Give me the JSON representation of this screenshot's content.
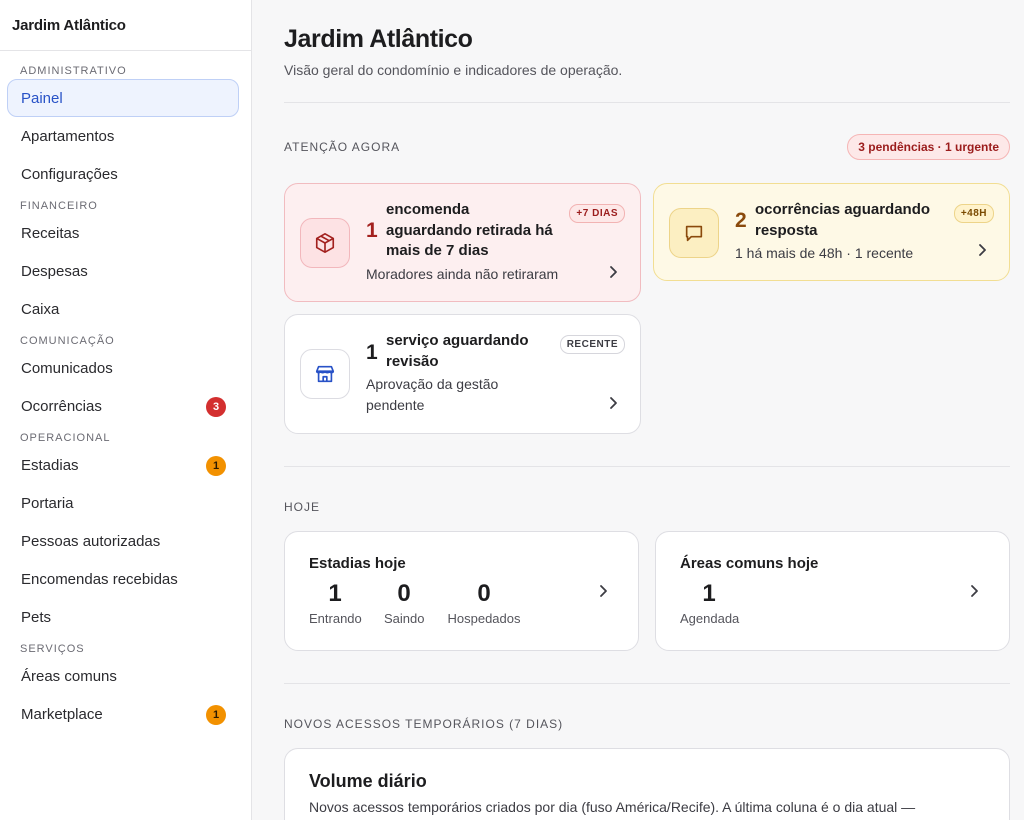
{
  "sidebar": {
    "brand": "Jardim Atlântico",
    "sections": [
      {
        "title": "ADMINISTRATIVO",
        "items": [
          {
            "label": "Painel",
            "active": true
          },
          {
            "label": "Apartamentos"
          },
          {
            "label": "Configurações"
          }
        ]
      },
      {
        "title": "FINANCEIRO",
        "items": [
          {
            "label": "Receitas"
          },
          {
            "label": "Despesas"
          },
          {
            "label": "Caixa"
          }
        ]
      },
      {
        "title": "COMUNICAÇÃO",
        "items": [
          {
            "label": "Comunicados"
          },
          {
            "label": "Ocorrências",
            "badge": "3",
            "badge_color": "#d32f2f"
          }
        ]
      },
      {
        "title": "OPERACIONAL",
        "items": [
          {
            "label": "Estadias",
            "badge": "1",
            "badge_color": "#f29100"
          },
          {
            "label": "Portaria"
          },
          {
            "label": "Pessoas autorizadas"
          },
          {
            "label": "Encomendas recebidas"
          },
          {
            "label": "Pets"
          }
        ]
      },
      {
        "title": "SERVIÇOS",
        "items": [
          {
            "label": "Áreas comuns"
          },
          {
            "label": "Marketplace",
            "badge": "1",
            "badge_color": "#f29100"
          }
        ]
      }
    ]
  },
  "header": {
    "title": "Jardim Atlântico",
    "subtitle": "Visão geral do condomínio e indicadores de operação."
  },
  "attention": {
    "label": "ATENÇÃO AGORA",
    "summary_pill": "3 pendências · 1 urgente",
    "cards": [
      {
        "number": "1",
        "title_line1": "encomenda",
        "title_line2": "aguardando retirada há",
        "title_line3": "mais de 7 dias",
        "desc": "Moradores ainda não retiraram",
        "tag": "+7 DIAS",
        "icon": "package-icon"
      },
      {
        "number": "2",
        "title_line1": "ocorrências aguardando",
        "title_line2": "resposta",
        "desc": "1 há mais de 48h · 1 recente",
        "tag": "+48H",
        "icon": "message-icon"
      },
      {
        "number": "1",
        "title_line1": "serviço aguardando",
        "title_line2": "revisão",
        "desc_line1": "Aprovação da gestão",
        "desc_line2": "pendente",
        "tag": "RECENTE",
        "icon": "store-icon"
      }
    ]
  },
  "today": {
    "label": "HOJE",
    "stays": {
      "title": "Estadias hoje",
      "stats": [
        {
          "value": "1",
          "label": "Entrando"
        },
        {
          "value": "0",
          "label": "Saindo"
        },
        {
          "value": "0",
          "label": "Hospedados"
        }
      ]
    },
    "areas": {
      "title": "Áreas comuns hoje",
      "stats": [
        {
          "value": "1",
          "label": "Agendada"
        }
      ]
    }
  },
  "access": {
    "label": "NOVOS ACESSOS TEMPORÁRIOS (7 DIAS)",
    "card_title": "Volume diário",
    "card_desc": "Novos acessos temporários criados por dia (fuso América/Recife). A última coluna é o dia atual —"
  },
  "colors": {
    "accent": "#2852c7",
    "urgent": "#d32f2f",
    "warning": "#f29100"
  }
}
